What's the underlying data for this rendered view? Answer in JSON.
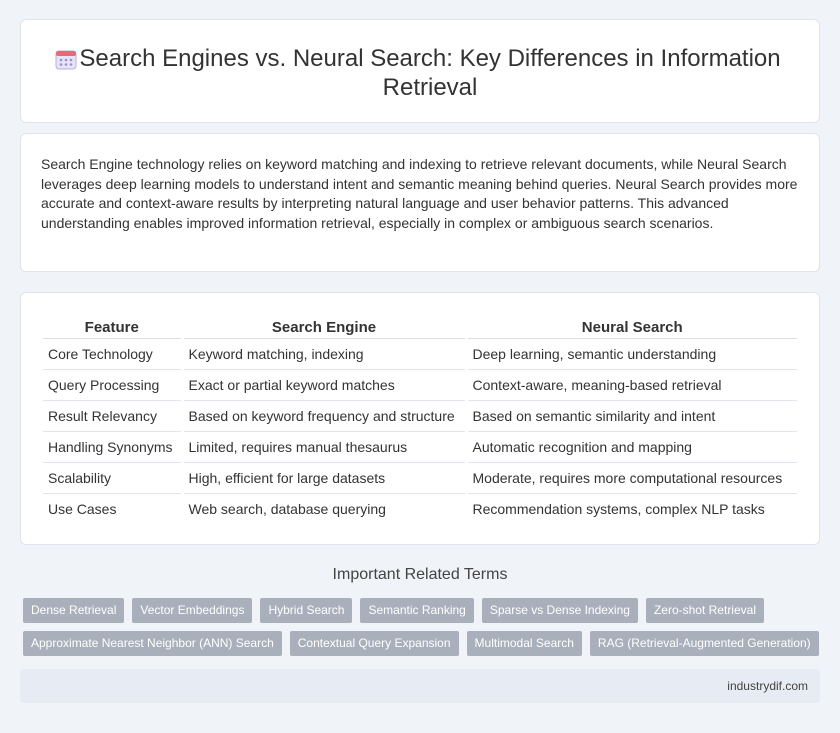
{
  "header": {
    "title": "Search Engines vs. Neural Search: Key Differences in Information Retrieval",
    "icon": "calendar-icon"
  },
  "intro": "Search Engine technology relies on keyword matching and indexing to retrieve relevant documents, while Neural Search leverages deep learning models to understand intent and semantic meaning behind queries. Neural Search provides more accurate and context-aware results by interpreting natural language and user behavior patterns. This advanced understanding enables improved information retrieval, especially in complex or ambiguous search scenarios.",
  "table": {
    "headers": [
      "Feature",
      "Search Engine",
      "Neural Search"
    ],
    "rows": [
      [
        "Core Technology",
        "Keyword matching, indexing",
        "Deep learning, semantic understanding"
      ],
      [
        "Query Processing",
        "Exact or partial keyword matches",
        "Context-aware, meaning-based retrieval"
      ],
      [
        "Result Relevancy",
        "Based on keyword frequency and structure",
        "Based on semantic similarity and intent"
      ],
      [
        "Handling Synonyms",
        "Limited, requires manual thesaurus",
        "Automatic recognition and mapping"
      ],
      [
        "Scalability",
        "High, efficient for large datasets",
        "Moderate, requires more computational resources"
      ],
      [
        "Use Cases",
        "Web search, database querying",
        "Recommendation systems, complex NLP tasks"
      ]
    ]
  },
  "related": {
    "title": "Important Related Terms",
    "rows": [
      [
        "Dense Retrieval",
        "Vector Embeddings",
        "Hybrid Search",
        "Semantic Ranking",
        "Sparse vs Dense Indexing",
        "Zero-shot Retrieval"
      ],
      [
        "Approximate Nearest Neighbor (ANN) Search",
        "Contextual Query Expansion",
        "Multimodal Search",
        "RAG (Retrieval-Augmented Generation)"
      ]
    ]
  },
  "footer": {
    "site": "industrydif.com"
  },
  "colors": {
    "tag_bg": "#a9b0bc",
    "page_bg": "#f0f3f8",
    "footer_bg": "#e7ebf4"
  }
}
